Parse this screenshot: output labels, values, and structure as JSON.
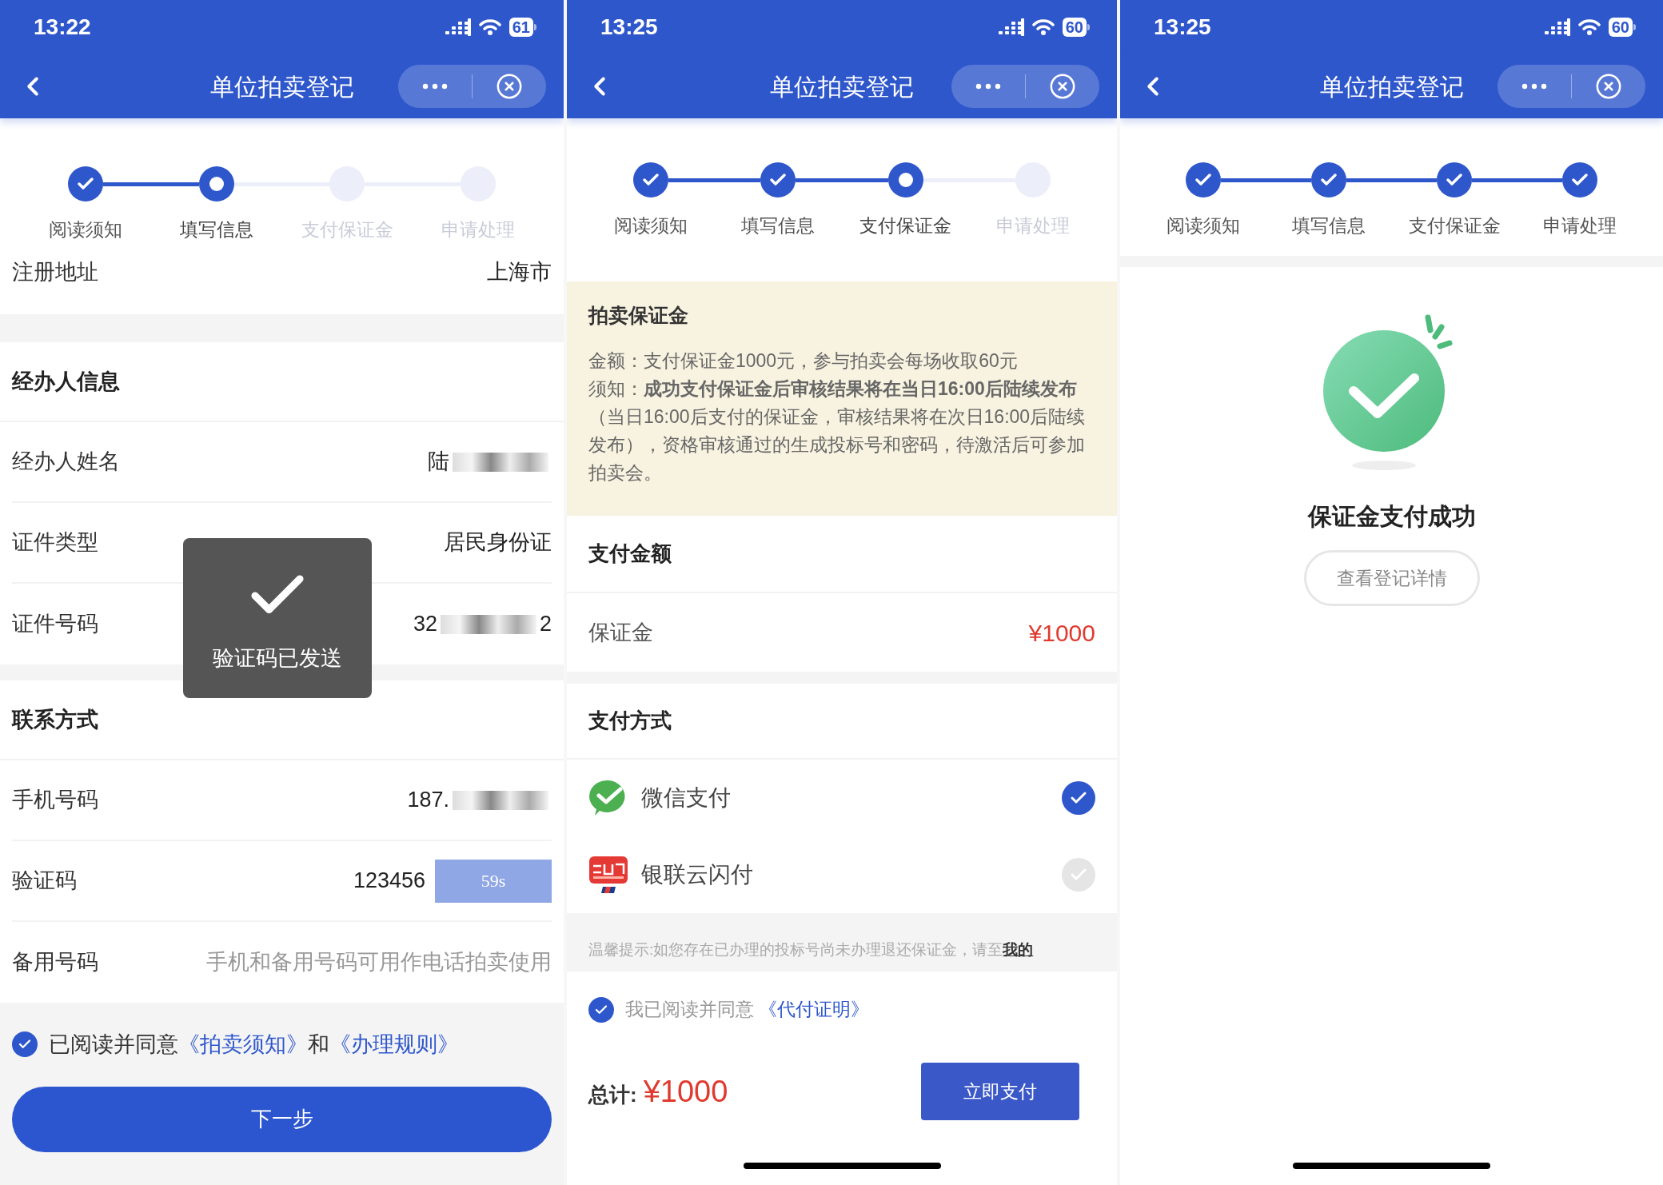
{
  "screens": [
    {
      "kind": "form",
      "status_bar": {
        "time": "13:22",
        "battery": "61"
      },
      "nav": {
        "title": "单位拍卖登记"
      },
      "steps": [
        {
          "label": "阅读须知",
          "done": true,
          "selected": false
        },
        {
          "label": "填写信息",
          "done": false,
          "selected": true
        },
        {
          "label": "支付保证金",
          "done": false,
          "selected": false
        },
        {
          "label": "申请处理",
          "done": false,
          "selected": false
        }
      ],
      "address_row": {
        "label": "注册地址",
        "value": "上海市"
      },
      "sections": [
        {
          "title": "经办人信息",
          "rows": [
            {
              "label": "经办人姓名",
              "value": "陆",
              "masked": true
            },
            {
              "label": "证件类型",
              "value": "居民身份证"
            },
            {
              "label": "证件号码",
              "value": "32",
              "value_end": "2",
              "masked": true
            }
          ]
        },
        {
          "title": "联系方式",
          "rows": [
            {
              "label": "手机号码",
              "value": "187.",
              "masked": true
            },
            {
              "label": "验证码",
              "value": "123456",
              "timer": "59s"
            },
            {
              "label": "备用号码",
              "placeholder": "手机和备用号码可用作电话拍卖使用"
            }
          ]
        }
      ],
      "agreement": {
        "checked": true,
        "parts": [
          {
            "kind": "text",
            "text": "已阅读并同意"
          },
          {
            "kind": "link",
            "text": "《拍卖须知》"
          },
          {
            "kind": "text",
            "text": "和"
          },
          {
            "kind": "link",
            "text": "《办理规则》"
          }
        ]
      },
      "primary_button": "下一步",
      "toast": {
        "text": "验证码已发送"
      }
    },
    {
      "kind": "payment",
      "status_bar": {
        "time": "13:25",
        "battery": "60"
      },
      "nav": {
        "title": "单位拍卖登记"
      },
      "steps": [
        {
          "label": "阅读须知",
          "done": true,
          "selected": false
        },
        {
          "label": "填写信息",
          "done": true,
          "selected": false
        },
        {
          "label": "支付保证金",
          "done": false,
          "selected": true
        },
        {
          "label": "申请处理",
          "done": false,
          "selected": false
        }
      ],
      "notice": {
        "title": "拍卖保证金",
        "lines": [
          "金额：支付保证金1000元，参与拍卖会每场收取60元",
          "须知：**成功支付保证金后审核结果将在当日16:00后陆续发布**（当日16:00后支付的保证金，审核结果将在次日16:00后陆续发布），资格审核通过的生成投标号和密码，待激活后可参加拍卖会。"
        ]
      },
      "amount": {
        "title": "支付金额",
        "label": "保证金",
        "value": "¥1000"
      },
      "methods": {
        "title": "支付方式",
        "items": [
          {
            "name": "微信支付",
            "kind": "wechat",
            "selected": true
          },
          {
            "name": "银联云闪付",
            "kind": "unionpay",
            "selected": false
          }
        ]
      },
      "tip": {
        "text": "温馨提示:如您存在已办理的投标号尚未办理退还保证金，请至",
        "link": "我的"
      },
      "agreement": {
        "checked": true,
        "parts": [
          {
            "kind": "text",
            "text": "我已阅读并同意 "
          },
          {
            "kind": "link",
            "text": "《代付证明》"
          }
        ]
      },
      "total": {
        "label": "总计:",
        "value": "¥1000"
      },
      "pay_button": "立即支付"
    },
    {
      "kind": "success",
      "status_bar": {
        "time": "13:25",
        "battery": "60"
      },
      "nav": {
        "title": "单位拍卖登记"
      },
      "steps": [
        {
          "label": "阅读须知",
          "done": true,
          "selected": false
        },
        {
          "label": "填写信息",
          "done": true,
          "selected": false
        },
        {
          "label": "支付保证金",
          "done": true,
          "selected": false
        },
        {
          "label": "申请处理",
          "done": true,
          "selected": false
        }
      ],
      "result": {
        "title": "保证金支付成功",
        "button": "查看登记详情"
      }
    }
  ]
}
